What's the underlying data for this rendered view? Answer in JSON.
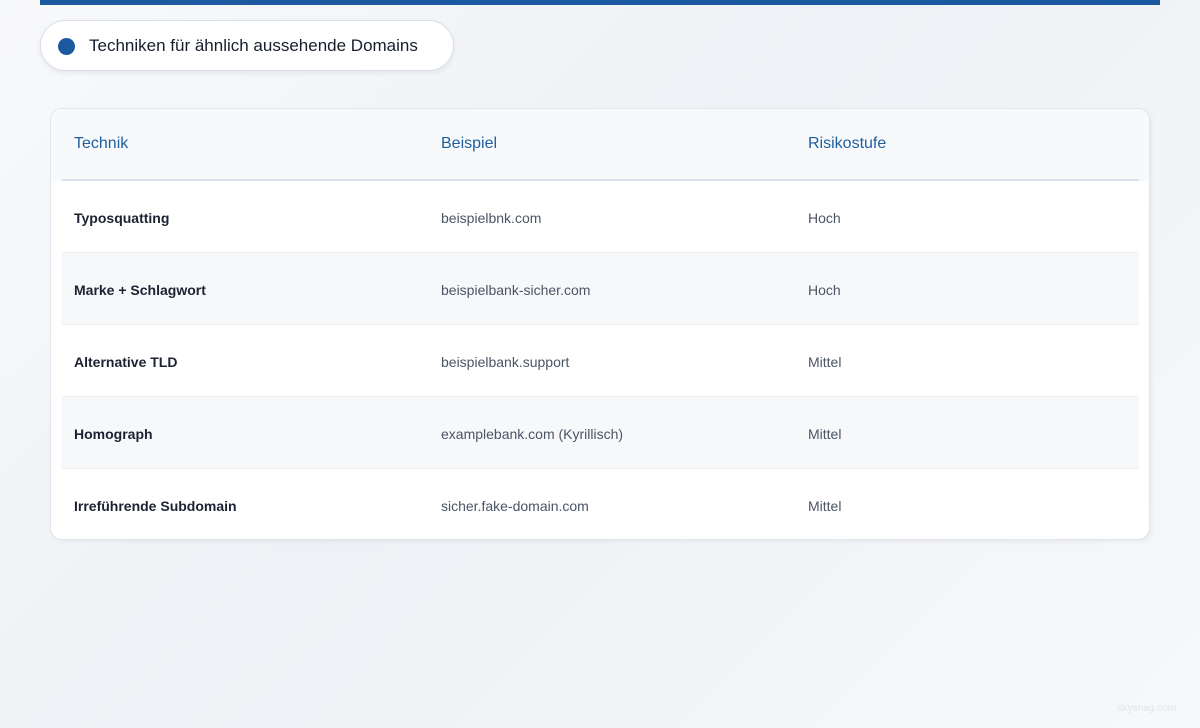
{
  "header": {
    "title": "Techniken für ähnlich aussehende Domains",
    "accent_color": "#1c5aa0"
  },
  "table": {
    "columns": [
      "Technik",
      "Beispiel",
      "Risikostufe"
    ],
    "rows": [
      {
        "technique": "Typosquatting",
        "example": "beispielbnk.com",
        "risk": "Hoch"
      },
      {
        "technique": "Marke + Schlagwort",
        "example": "beispielbank-sicher.com",
        "risk": "Hoch"
      },
      {
        "technique": "Alternative TLD",
        "example": "beispielbank.support",
        "risk": "Mittel"
      },
      {
        "technique": "Homograph",
        "example": "examplebank.com (Kyrillisch)",
        "risk": "Mittel"
      },
      {
        "technique": "Irreführende Subdomain",
        "example": "sicher.fake-domain.com",
        "risk": "Mittel"
      }
    ]
  },
  "footer": {
    "watermark": "skysnag.com"
  }
}
